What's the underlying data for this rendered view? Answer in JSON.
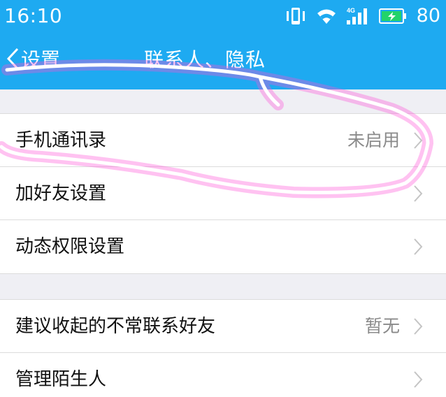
{
  "status_bar": {
    "time": "16:10",
    "battery": "80",
    "icons": [
      "vibrate-icon",
      "wifi-icon",
      "signal-4g-icon",
      "battery-charging-icon"
    ]
  },
  "nav": {
    "back_label": "设置",
    "title": "联系人、隐私"
  },
  "groups": [
    {
      "rows": [
        {
          "label": "手机通讯录",
          "value": "未启用"
        },
        {
          "label": "加好友设置",
          "value": ""
        },
        {
          "label": "动态权限设置",
          "value": ""
        }
      ]
    },
    {
      "rows": [
        {
          "label": "建议收起的不常联系好友",
          "value": "暂无"
        },
        {
          "label": "管理陌生人",
          "value": ""
        }
      ]
    }
  ],
  "colors": {
    "accent": "#1eaaf1",
    "background": "#efeff4",
    "row_bg": "#ffffff",
    "secondary_text": "#8a8a8a",
    "annotation_stroke": "#ff4fd8"
  }
}
